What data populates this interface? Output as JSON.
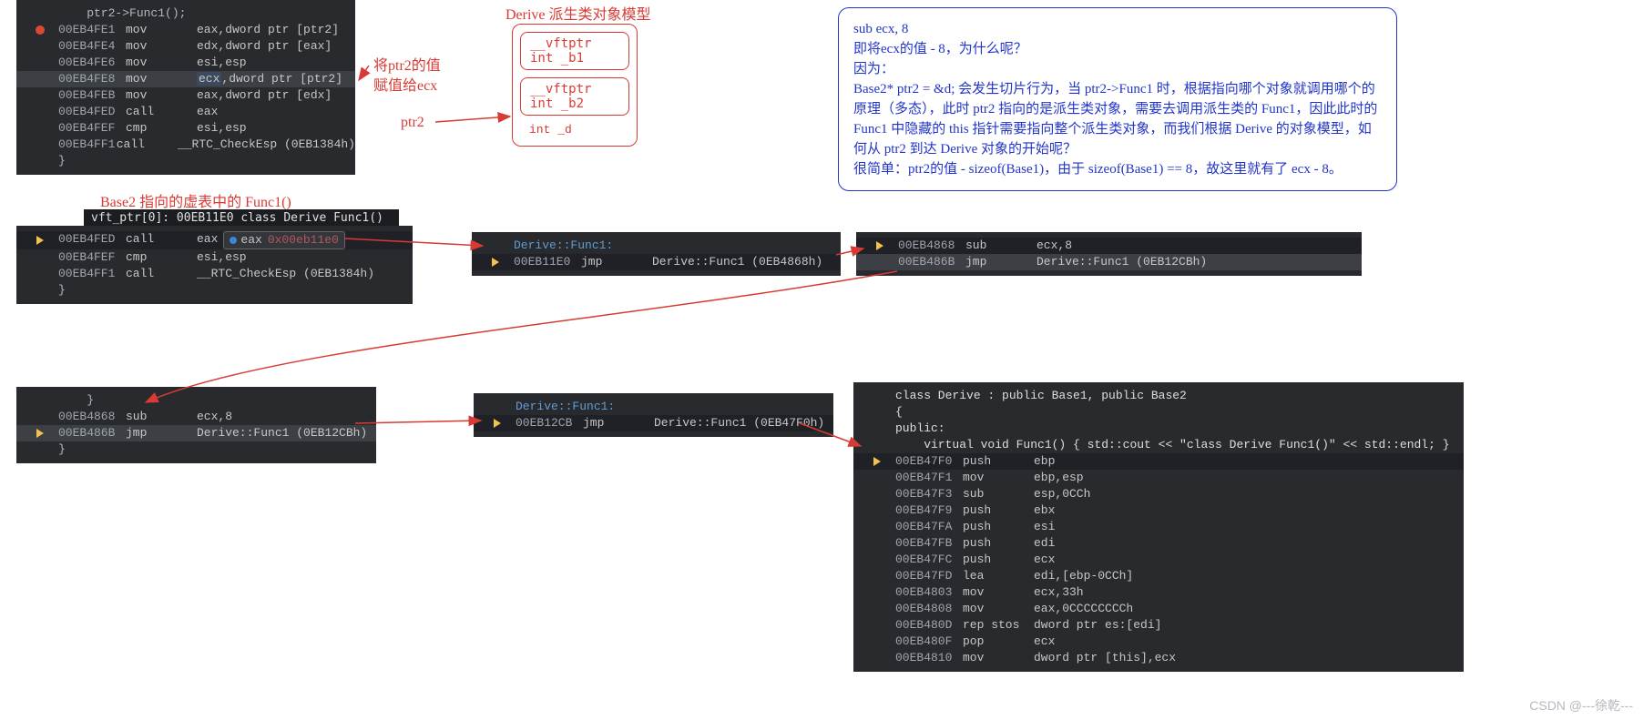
{
  "annotations": {
    "derive_model_title": "Derive 派生类对象模型",
    "assign_line1": "将ptr2的值",
    "assign_line2": "赋值给ecx",
    "ptr2_label": "ptr2",
    "base2_vft_title": "Base2 指向的虚表中的 Func1()"
  },
  "object_model": {
    "box1": {
      "l1": "__vftptr",
      "l2": "int _b1"
    },
    "box2": {
      "l1": "__vftptr",
      "l2": "int _b2"
    },
    "extra": "int _d"
  },
  "blue_note": {
    "l0": "sub   ecx, 8",
    "l1": "即将ecx的值 - 8，为什么呢？",
    "l2": "因为：",
    "l3": "Base2* ptr2 = &d; 会发生切片行为，当 ptr2->Func1 时，根据指向哪个对象就调用哪个的原理（多态），此时 ptr2 指向的是派生类对象，需要去调用派生类的 Func1，因此此时的 Func1 中隐藏的 this 指针需要指向整个派生类对象，而我们根据 Derive 的对象模型，如何从 ptr2 到达 Derive 对象的开始呢？",
    "l4": "很简单：ptr2的值 - sizeof(Base1)，由于 sizeof(Base1) == 8，故这里就有了 ecx - 8。"
  },
  "block1": {
    "title": "    ptr2->Func1();",
    "lines": [
      {
        "addr": "00EB4FE1",
        "mnem": "mov",
        "op": "eax,dword ptr [ptr2]",
        "mark": "bp"
      },
      {
        "addr": "00EB4FE4",
        "mnem": "mov",
        "op": "edx,dword ptr [eax]"
      },
      {
        "addr": "00EB4FE6",
        "mnem": "mov",
        "op": "esi,esp"
      },
      {
        "addr": "00EB4FE8",
        "mnem": "mov",
        "op": "ecx,dword ptr [ptr2]",
        "hl": true
      },
      {
        "addr": "00EB4FEB",
        "mnem": "mov",
        "op": "eax,dword ptr [edx]"
      },
      {
        "addr": "00EB4FED",
        "mnem": "call",
        "op": "eax"
      },
      {
        "addr": "00EB4FEF",
        "mnem": "cmp",
        "op": "esi,esp"
      },
      {
        "addr": "00EB4FF1",
        "mnem": "call",
        "op": "__RTC_CheckEsp (0EB1384h)"
      }
    ],
    "trail": "}"
  },
  "vft_line": "vft_ptr[0]: 00EB11E0 class Derive Func1()",
  "block2": {
    "eax_name": "eax",
    "eax_val": "0x00eb11e0",
    "lines": [
      {
        "addr": "00EB4FED",
        "mnem": "call",
        "op": "eax",
        "mark": "arrow"
      },
      {
        "addr": "00EB4FEF",
        "mnem": "cmp",
        "op": "esi,esp"
      },
      {
        "addr": "00EB4FF1",
        "mnem": "call",
        "op": "__RTC_CheckEsp (0EB1384h)"
      }
    ],
    "trail": "}"
  },
  "block3": {
    "title": "Derive::Func1:",
    "line": {
      "addr": "00EB11E0",
      "mnem": "jmp",
      "op": "Derive::Func1 (0EB4868h)",
      "mark": "arrow"
    }
  },
  "block4": {
    "lines": [
      {
        "addr": "00EB4868",
        "mnem": "sub",
        "op": "ecx,8",
        "mark": "arrow"
      },
      {
        "addr": "00EB486B",
        "mnem": "jmp",
        "op": "Derive::Func1 (0EB12CBh)",
        "hl": true
      }
    ]
  },
  "block5": {
    "lines": [
      {
        "addr": "00EB4868",
        "mnem": "sub",
        "op": "ecx,8"
      },
      {
        "addr": "00EB486B",
        "mnem": "jmp",
        "op": "Derive::Func1 (0EB12CBh)",
        "mark": "arrow",
        "hl": true
      }
    ],
    "trail": "}"
  },
  "block6": {
    "title": "Derive::Func1:",
    "line": {
      "addr": "00EB12CB",
      "mnem": "jmp",
      "op": "Derive::Func1 (0EB47F0h)",
      "mark": "arrow"
    }
  },
  "block7": {
    "src0": "class Derive : public Base1, public Base2",
    "src1": "{",
    "src2": "public:",
    "src3": "    virtual void Func1() { std::cout << \"class Derive Func1()\" << std::endl; }",
    "lines": [
      {
        "addr": "00EB47F0",
        "mnem": "push",
        "op": "ebp",
        "mark": "arrow"
      },
      {
        "addr": "00EB47F1",
        "mnem": "mov",
        "op": "ebp,esp"
      },
      {
        "addr": "00EB47F3",
        "mnem": "sub",
        "op": "esp,0CCh"
      },
      {
        "addr": "00EB47F9",
        "mnem": "push",
        "op": "ebx"
      },
      {
        "addr": "00EB47FA",
        "mnem": "push",
        "op": "esi"
      },
      {
        "addr": "00EB47FB",
        "mnem": "push",
        "op": "edi"
      },
      {
        "addr": "00EB47FC",
        "mnem": "push",
        "op": "ecx"
      },
      {
        "addr": "00EB47FD",
        "mnem": "lea",
        "op": "edi,[ebp-0CCh]"
      },
      {
        "addr": "00EB4803",
        "mnem": "mov",
        "op": "ecx,33h"
      },
      {
        "addr": "00EB4808",
        "mnem": "mov",
        "op": "eax,0CCCCCCCCh"
      },
      {
        "addr": "00EB480D",
        "mnem": "rep stos",
        "op": "dword ptr es:[edi]"
      },
      {
        "addr": "00EB480F",
        "mnem": "pop",
        "op": "ecx"
      },
      {
        "addr": "00EB4810",
        "mnem": "mov",
        "op": "dword ptr [this],ecx"
      }
    ]
  },
  "watermark": "CSDN @---徐乾---"
}
